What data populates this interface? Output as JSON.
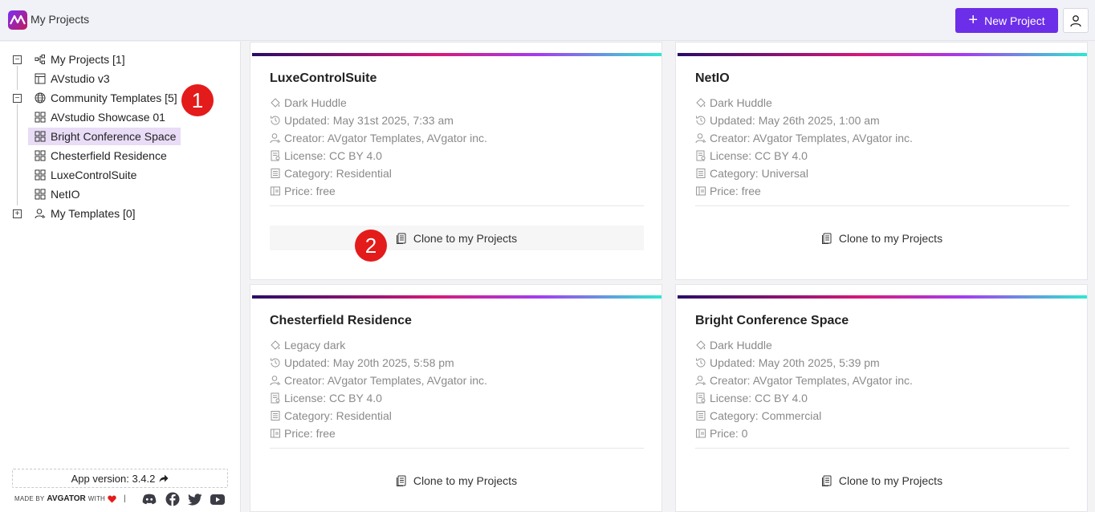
{
  "header": {
    "app_title": "My Projects",
    "new_project_label": "New Project",
    "logo_icon": "avgator-logo",
    "accent": "#6c2ee8"
  },
  "sidebar": {
    "tree": [
      {
        "label": "My Projects [1]",
        "icon": "project-tree-icon"
      },
      {
        "label": "AVstudio v3",
        "icon": "layout-icon"
      },
      {
        "label": "Community Templates [5]",
        "icon": "globe-icon"
      },
      {
        "label": "AVstudio Showcase 01",
        "icon": "template-icon"
      },
      {
        "label": "Bright Conference Space",
        "icon": "template-icon"
      },
      {
        "label": "Chesterfield Residence",
        "icon": "template-icon"
      },
      {
        "label": "LuxeControlSuite",
        "icon": "template-icon"
      },
      {
        "label": "NetIO",
        "icon": "template-icon"
      },
      {
        "label": "My Templates [0]",
        "icon": "user-icon"
      }
    ],
    "app_version": "App version: 3.4.2",
    "made_by_prefix": "MADE BY",
    "made_by_brand": "AVGATOR",
    "made_by_with": "WITH",
    "separator": "|"
  },
  "annotations": {
    "badge1": "1",
    "badge2": "2"
  },
  "cards": [
    {
      "title": "LuxeControlSuite",
      "theme": "Dark Huddle",
      "updated": "Updated: May 31st 2025, 7:33 am",
      "creator": "Creator: AVgator Templates, AVgator inc.",
      "license": "License: CC BY 4.0",
      "category": "Category: Residential",
      "price": "Price: free",
      "clone_label": "Clone to my Projects"
    },
    {
      "title": "NetIO",
      "theme": "Dark Huddle",
      "updated": "Updated: May 26th 2025, 1:00 am",
      "creator": "Creator: AVgator Templates, AVgator inc.",
      "license": "License: CC BY 4.0",
      "category": "Category: Universal",
      "price": "Price: free",
      "clone_label": "Clone to my Projects"
    },
    {
      "title": "Chesterfield Residence",
      "theme": "Legacy dark",
      "updated": "Updated: May 20th 2025, 5:58 pm",
      "creator": "Creator: AVgator Templates, AVgator inc.",
      "license": "License: CC BY 4.0",
      "category": "Category: Residential",
      "price": "Price: free",
      "clone_label": "Clone to my Projects"
    },
    {
      "title": "Bright Conference Space",
      "theme": "Dark Huddle",
      "updated": "Updated: May 20th 2025, 5:39 pm",
      "creator": "Creator: AVgator Templates, AVgator inc.",
      "license": "License: CC BY 4.0",
      "category": "Category: Commercial",
      "price": "Price: 0",
      "clone_label": "Clone to my Projects"
    }
  ]
}
